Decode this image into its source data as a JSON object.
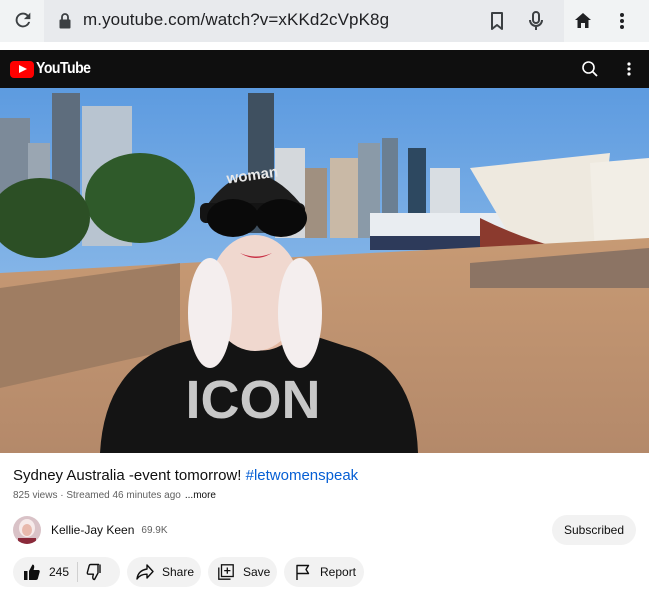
{
  "browser": {
    "url": "m.youtube.com/watch?v=xKKd2cVpK8g"
  },
  "header": {
    "logo_text": "YouTube"
  },
  "video": {
    "cap_text": "woman",
    "shirt_text": "ICON"
  },
  "info": {
    "title_main": "Sydney Australia -event tomorrow! ",
    "title_hashtag": "#letwomenspeak",
    "meta": "825 views · Streamed 46 minutes ago",
    "more": "...more"
  },
  "channel": {
    "name": "Kellie-Jay Keen",
    "subscribers": "69.9K",
    "subscribe_label": "Subscribed"
  },
  "actions": {
    "like_count": "245",
    "share_label": "Share",
    "save_label": "Save",
    "report_label": "Report"
  }
}
